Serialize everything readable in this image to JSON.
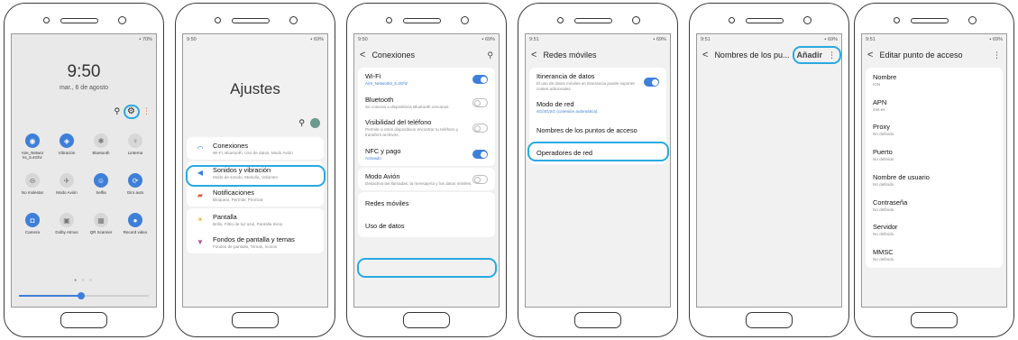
{
  "screens": [
    {
      "status": {
        "left": "",
        "right": "▪ 70%"
      },
      "clock": "9:50",
      "date": "mar., 6 de agosto",
      "tiles": [
        {
          "label": "Aire_Networ ks_5.4Ghz",
          "glyph": "◉",
          "on": true
        },
        {
          "label": "Vibración",
          "glyph": "◈",
          "on": true
        },
        {
          "label": "Bluetooth",
          "glyph": "✱",
          "on": false
        },
        {
          "label": "Linterna",
          "glyph": "♆",
          "on": false
        },
        {
          "label": "No molestar",
          "glyph": "⊖",
          "on": false
        },
        {
          "label": "Modo Avión",
          "glyph": "✈",
          "on": false
        },
        {
          "label": "Selfia",
          "glyph": "☺",
          "on": true
        },
        {
          "label": "Giro auto",
          "glyph": "⟳",
          "on": true
        },
        {
          "label": "Camera",
          "glyph": "◘",
          "on": true
        },
        {
          "label": "Dolby Atmos",
          "glyph": "▣",
          "on": false
        },
        {
          "label": "QR Scanner",
          "glyph": "▦",
          "on": false
        },
        {
          "label": "Record video",
          "glyph": "●",
          "on": true
        }
      ]
    },
    {
      "status": {
        "left": "9:50",
        "right": "▪ 69%"
      },
      "title": "Ajustes",
      "items": [
        {
          "title": "Conexiones",
          "sub": "Wi-Fi, Bluetooth, Uso de datos, Modo Avión"
        },
        {
          "title": "Sonidos y vibración",
          "sub": "Modo de sonido, Melodía, Volumen"
        },
        {
          "title": "Notificaciones",
          "sub": "Bloquear, Permitir, Priorizar"
        },
        {
          "title": "Pantalla",
          "sub": "Brillo, Filtro de luz azul, Pantalla Inicio"
        },
        {
          "title": "Fondos de pantalla y temas",
          "sub": "Fondos de pantalla, Temas, Iconos"
        }
      ]
    },
    {
      "status": {
        "left": "9:50",
        "right": "▪ 69%"
      },
      "title": "Conexiones",
      "items": [
        {
          "title": "Wi-Fi",
          "sub": "Aire_Networks_5.4Ghz"
        },
        {
          "title": "Bluetooth",
          "sub": "Se conecta a dispositivos Bluetooth cercanos."
        },
        {
          "title": "Visibilidad del teléfono",
          "sub": "Permite a otros dispositivos encontrar tu teléfono y transferir archivos."
        },
        {
          "title": "NFC y pago",
          "sub": "Activado"
        },
        {
          "title": "Modo Avión",
          "sub": "Desactiva las llamadas, la mensajería y los datos móviles."
        },
        {
          "title": "Redes móviles",
          "sub": ""
        },
        {
          "title": "Uso de datos",
          "sub": ""
        }
      ]
    },
    {
      "status": {
        "left": "9:51",
        "right": "▪ 69%"
      },
      "title": "Redes móviles",
      "items": [
        {
          "title": "Itinerancia de datos",
          "sub": "El uso de datos móviles en itinerancia puede suponer costes adicionales."
        },
        {
          "title": "Modo de red",
          "sub": "4G/3G/2G (conexión automática)"
        },
        {
          "title": "Nombres de los puntos de acceso",
          "sub": ""
        },
        {
          "title": "Operadores de red",
          "sub": ""
        }
      ]
    },
    {
      "status": {
        "left": "9:51",
        "right": "▪ 69%"
      },
      "title": "Nombres de los pu...",
      "action": "Añadir"
    },
    {
      "status": {
        "left": "9:51",
        "right": "▪ 69%"
      },
      "title": "Editar punto de acceso",
      "items": [
        {
          "title": "Nombre",
          "sub": "ION"
        },
        {
          "title": "APN",
          "sub": "inet.es"
        },
        {
          "title": "Proxy",
          "sub": "No definido"
        },
        {
          "title": "Puerto",
          "sub": "No definido"
        },
        {
          "title": "Nombre de usuario",
          "sub": "No definido"
        },
        {
          "title": "Contraseña",
          "sub": "No definido"
        },
        {
          "title": "Servidor",
          "sub": "No definido"
        },
        {
          "title": "MMSC",
          "sub": "No definido"
        }
      ]
    }
  ],
  "colors": {
    "accent": "#3e7fd9",
    "highlight": "#29a9e1"
  }
}
